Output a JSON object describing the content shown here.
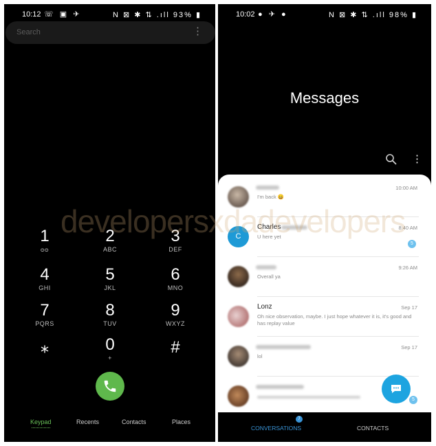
{
  "left_phone": {
    "status": {
      "time": "10:12",
      "icons": "☏ ▣ ✈",
      "right": "N ⊠ ✱ ⇅ .ıll",
      "battery": "93%"
    },
    "search": {
      "placeholder": "Search",
      "more_glyph": "⋮"
    },
    "keys": [
      {
        "digit": "1",
        "letters": "ᴑᴑ"
      },
      {
        "digit": "2",
        "letters": "ABC"
      },
      {
        "digit": "3",
        "letters": "DEF"
      },
      {
        "digit": "4",
        "letters": "GHI"
      },
      {
        "digit": "5",
        "letters": "JKL"
      },
      {
        "digit": "6",
        "letters": "MNO"
      },
      {
        "digit": "7",
        "letters": "PQRS"
      },
      {
        "digit": "8",
        "letters": "TUV"
      },
      {
        "digit": "9",
        "letters": "WXYZ"
      },
      {
        "digit": "⁎",
        "letters": ""
      },
      {
        "digit": "0",
        "letters": "+"
      },
      {
        "digit": "#",
        "letters": ""
      }
    ],
    "tabs": [
      {
        "label": "Keypad",
        "active": true
      },
      {
        "label": "Recents",
        "active": false
      },
      {
        "label": "Contacts",
        "active": false
      },
      {
        "label": "Places",
        "active": false
      }
    ],
    "call_color": "#5fb84c"
  },
  "right_phone": {
    "status": {
      "time": "10:02",
      "icons": "● ✈ ●",
      "right": "N ⊠ ✱ ⇅ .ıll",
      "battery": "98%"
    },
    "title": "Messages",
    "more_glyph": "⋮",
    "conversations": [
      {
        "name": "",
        "snippet": "I'm back 😄",
        "time": "10:00 AM",
        "badge": ""
      },
      {
        "name": "Charles",
        "avatar_letter": "C",
        "snippet": "U here yet",
        "time": "8:40 AM",
        "badge": "5"
      },
      {
        "name": "",
        "snippet": "Overall ya",
        "time": "9:26 AM",
        "badge": ""
      },
      {
        "name": "Lonz",
        "snippet": "Oh nice observation, maybe. I just hope whatever it is, it's good and has replay value",
        "time": "Sep 17",
        "badge": ""
      },
      {
        "name": "",
        "snippet": "lol",
        "time": "Sep 17",
        "badge": ""
      },
      {
        "name": "",
        "snippet": "",
        "time": "",
        "badge": "5"
      }
    ],
    "bottom_nav": [
      {
        "label": "CONVERSATIONS",
        "active": true,
        "badge": "7"
      },
      {
        "label": "CONTACTS",
        "active": false
      }
    ],
    "accent_color": "#1da4e0"
  },
  "watermark": "developersxdadevelopers"
}
